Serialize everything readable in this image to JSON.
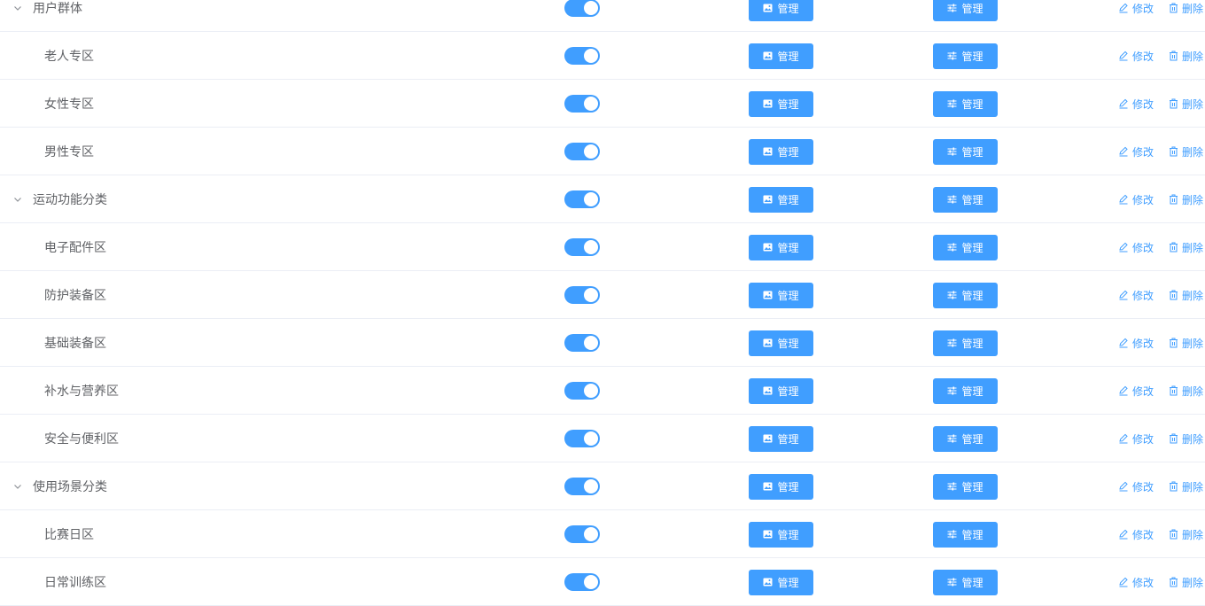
{
  "colors": {
    "primary": "#409eff",
    "text": "#606266",
    "divider": "#ebeef5"
  },
  "icons": {
    "expand": "chevron-down-icon",
    "image_manage": "picture-icon",
    "setting_manage": "sliders-icon",
    "edit": "edit-pencil-icon",
    "delete": "trash-icon"
  },
  "rows": [
    {
      "name": "用户群体",
      "level": 0,
      "expanded": true,
      "enabled": true,
      "image_btn": "管理",
      "setting_btn": "管理",
      "edit": "修改",
      "delete": "删除"
    },
    {
      "name": "老人专区",
      "level": 1,
      "enabled": true,
      "image_btn": "管理",
      "setting_btn": "管理",
      "edit": "修改",
      "delete": "删除"
    },
    {
      "name": "女性专区",
      "level": 1,
      "enabled": true,
      "image_btn": "管理",
      "setting_btn": "管理",
      "edit": "修改",
      "delete": "删除"
    },
    {
      "name": "男性专区",
      "level": 1,
      "enabled": true,
      "image_btn": "管理",
      "setting_btn": "管理",
      "edit": "修改",
      "delete": "删除"
    },
    {
      "name": "运动功能分类",
      "level": 0,
      "expanded": true,
      "enabled": true,
      "image_btn": "管理",
      "setting_btn": "管理",
      "edit": "修改",
      "delete": "删除"
    },
    {
      "name": "电子配件区",
      "level": 1,
      "enabled": true,
      "image_btn": "管理",
      "setting_btn": "管理",
      "edit": "修改",
      "delete": "删除"
    },
    {
      "name": "防护装备区",
      "level": 1,
      "enabled": true,
      "image_btn": "管理",
      "setting_btn": "管理",
      "edit": "修改",
      "delete": "删除"
    },
    {
      "name": "基础装备区",
      "level": 1,
      "enabled": true,
      "image_btn": "管理",
      "setting_btn": "管理",
      "edit": "修改",
      "delete": "删除"
    },
    {
      "name": "补水与营养区",
      "level": 1,
      "enabled": true,
      "image_btn": "管理",
      "setting_btn": "管理",
      "edit": "修改",
      "delete": "删除"
    },
    {
      "name": "安全与便利区",
      "level": 1,
      "enabled": true,
      "image_btn": "管理",
      "setting_btn": "管理",
      "edit": "修改",
      "delete": "删除"
    },
    {
      "name": "使用场景分类",
      "level": 0,
      "expanded": true,
      "enabled": true,
      "image_btn": "管理",
      "setting_btn": "管理",
      "edit": "修改",
      "delete": "删除"
    },
    {
      "name": "比赛日区",
      "level": 1,
      "enabled": true,
      "image_btn": "管理",
      "setting_btn": "管理",
      "edit": "修改",
      "delete": "删除"
    },
    {
      "name": "日常训练区",
      "level": 1,
      "enabled": true,
      "image_btn": "管理",
      "setting_btn": "管理",
      "edit": "修改",
      "delete": "删除"
    }
  ]
}
